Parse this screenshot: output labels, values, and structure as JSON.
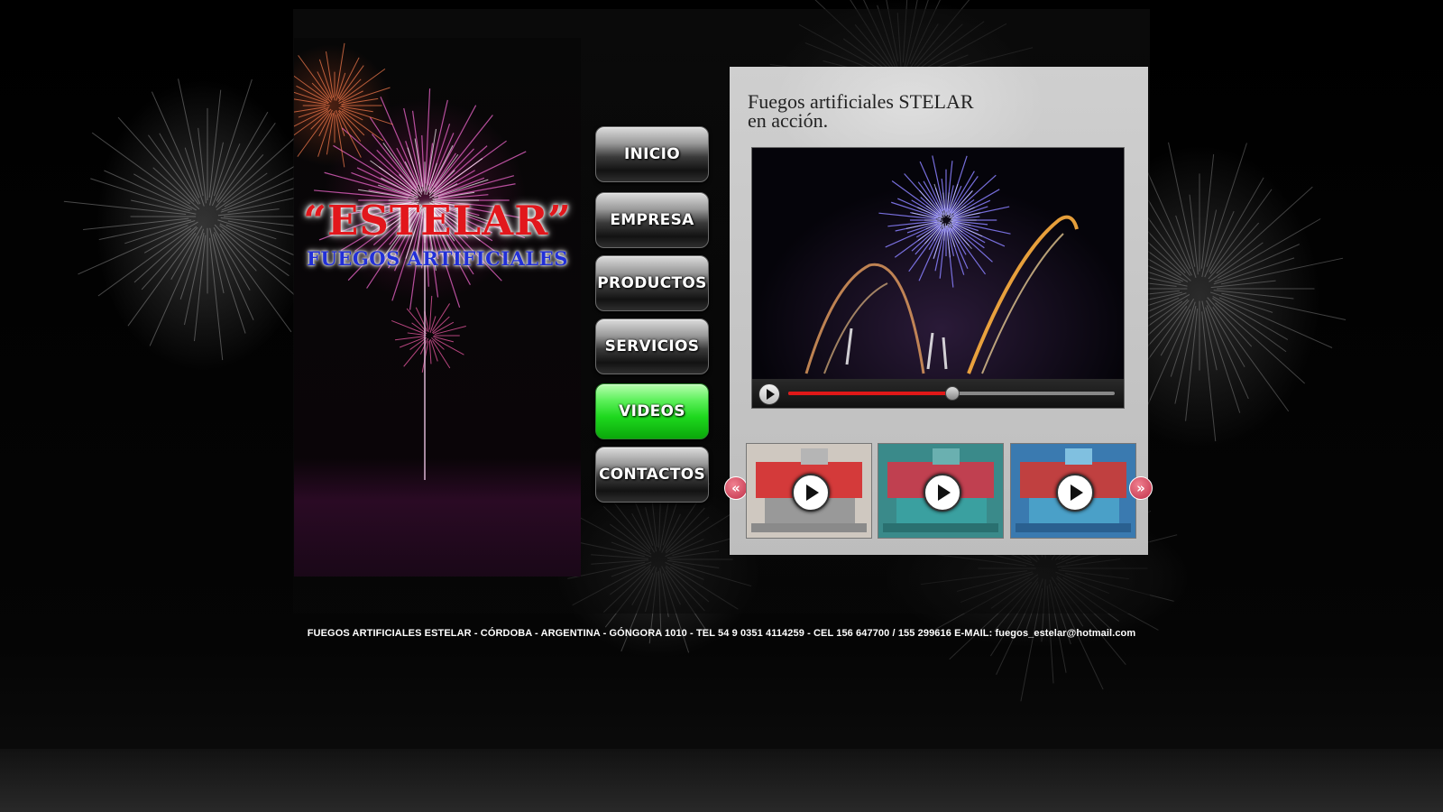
{
  "brand": {
    "name": "“ESTELAR”",
    "tagline": "FUEGOS ARTIFICIALES"
  },
  "nav": {
    "items": [
      {
        "label": "INICIO",
        "active": false
      },
      {
        "label": "EMPRESA",
        "active": false
      },
      {
        "label": "PRODUCTOS",
        "active": false
      },
      {
        "label": "SERVICIOS",
        "active": false
      },
      {
        "label": "VIDEOS",
        "active": true
      },
      {
        "label": "CONTACTOS",
        "active": false
      }
    ],
    "active_color": "#2ee02e"
  },
  "video_panel": {
    "title_line1": "Fuegos artificiales STELAR",
    "title_line2": "en acción.",
    "player": {
      "progress_fraction": 0.5,
      "progress_color": "#e01818"
    },
    "thumbnails": [
      {
        "tint": "neutral",
        "icon": "play-icon"
      },
      {
        "tint": "teal",
        "icon": "play-icon"
      },
      {
        "tint": "blue",
        "icon": "play-icon"
      }
    ],
    "prev_arrow": "«",
    "next_arrow": "»"
  },
  "footer": {
    "text": "FUEGOS ARTIFICIALES ESTELAR - CÓRDOBA - ARGENTINA - GÓNGORA  1010 - TEL 54 9 0351 4114259 - CEL  156 647700 / 155 299616 E-MAIL: fuegos_estelar@hotmail.com"
  },
  "colors": {
    "brand_red": "#e2171c",
    "brand_blue": "#2230d8",
    "arrow_pink": "#d04058"
  }
}
